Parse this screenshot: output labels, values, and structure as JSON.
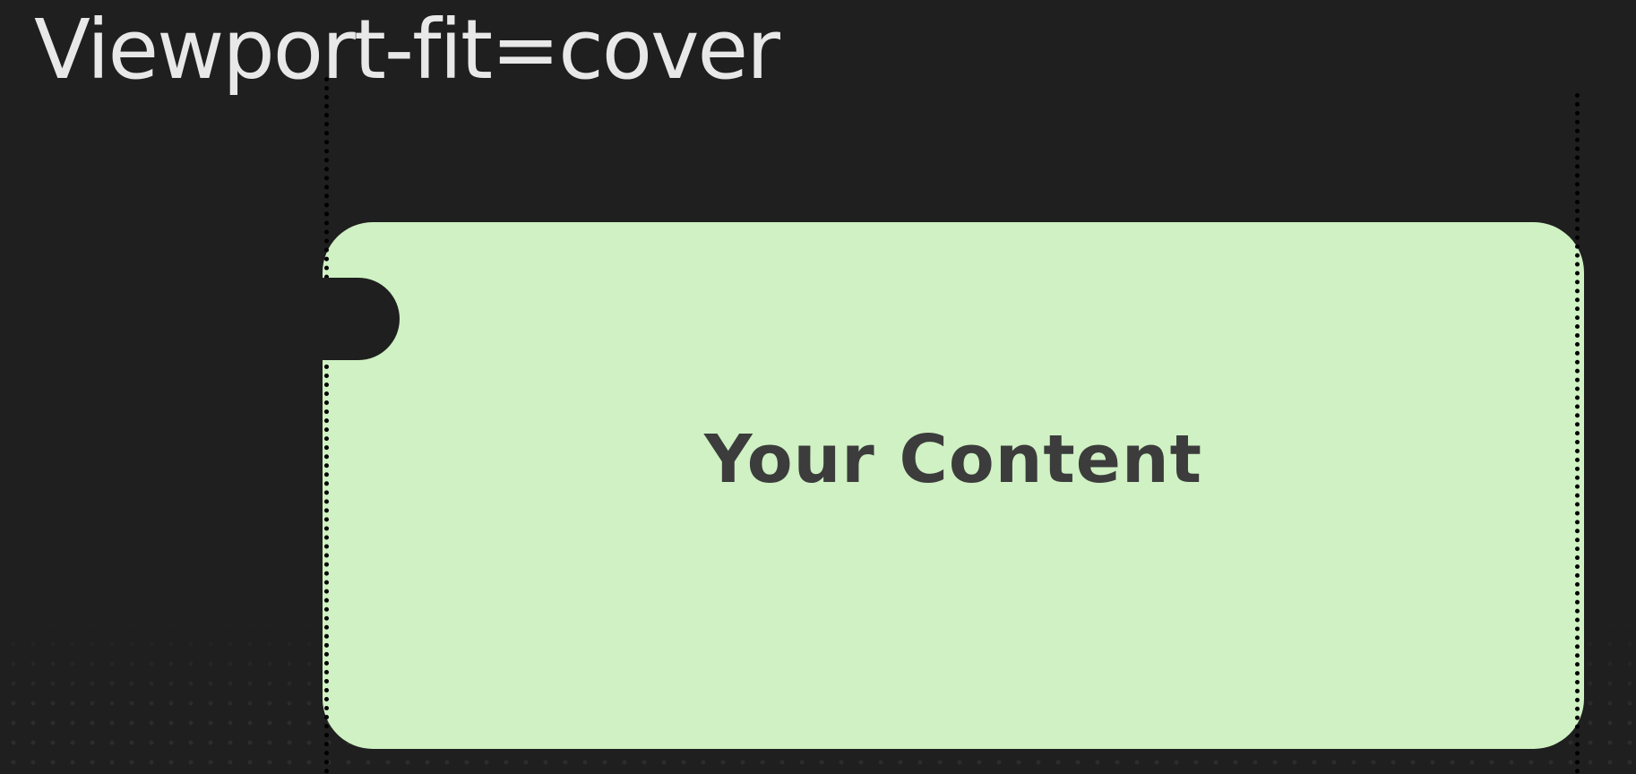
{
  "title": "Viewport-fit=cover",
  "content": {
    "label": "Your Content"
  },
  "colors": {
    "background": "#1f1f1f",
    "content_fill": "#cff1c3",
    "title_text": "#e8e8e8",
    "content_text": "#3c3c3c",
    "guide_lines": "#000000"
  }
}
